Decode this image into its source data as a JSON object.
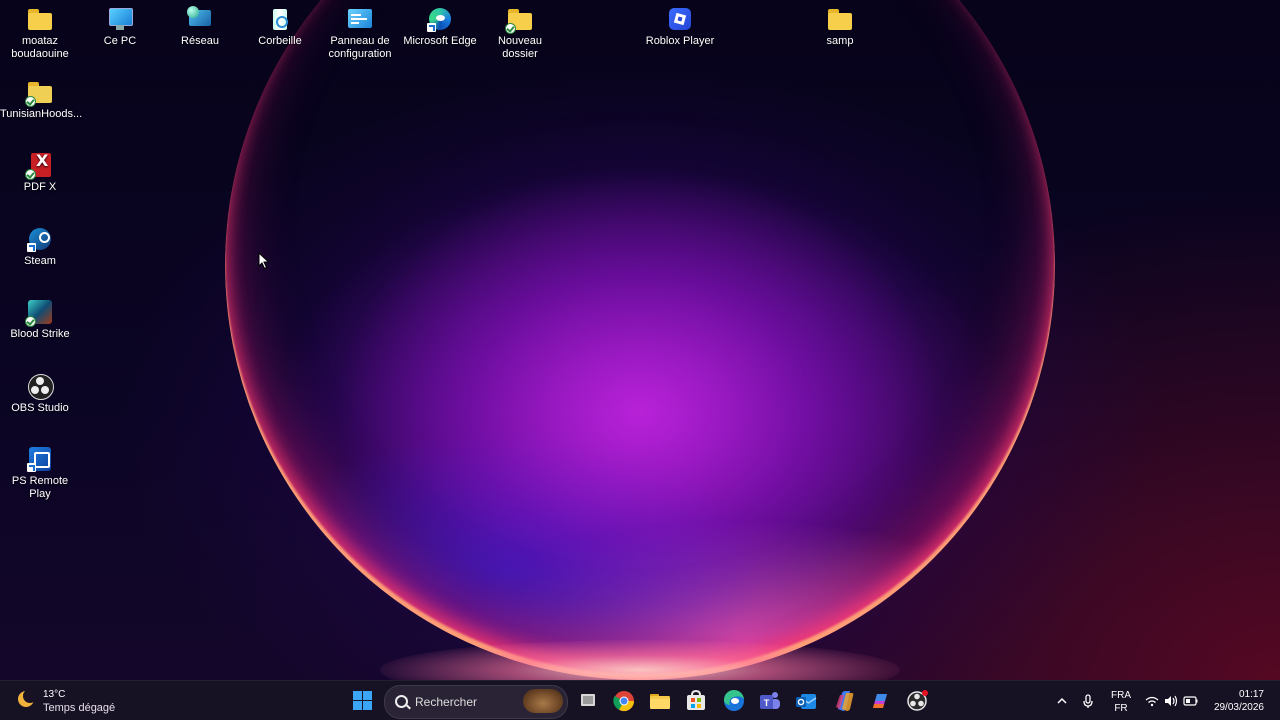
{
  "desktop": {
    "icons": [
      {
        "label": "moataz boudaouine",
        "icon": "folder-icon"
      },
      {
        "label": "Ce PC",
        "icon": "computer-icon"
      },
      {
        "label": "Réseau",
        "icon": "network-icon"
      },
      {
        "label": "Corbeille",
        "icon": "recycle-bin-icon"
      },
      {
        "label": "Panneau de configuration",
        "icon": "control-panel-icon"
      },
      {
        "label": "Microsoft Edge",
        "icon": "edge-icon"
      },
      {
        "label": "Nouveau dossier",
        "icon": "folder-icon"
      },
      {
        "label": "Roblox Player",
        "icon": "roblox-icon"
      },
      {
        "label": "samp",
        "icon": "folder-icon"
      },
      {
        "label": "TunisianHoods...",
        "icon": "folder-icon"
      },
      {
        "label": "PDF X",
        "icon": "pdf-icon"
      },
      {
        "label": "Steam",
        "icon": "steam-icon"
      },
      {
        "label": "Blood Strike",
        "icon": "game-icon"
      },
      {
        "label": "OBS Studio",
        "icon": "obs-icon"
      },
      {
        "label": "PS Remote Play",
        "icon": "ps-remote-play-icon"
      }
    ]
  },
  "taskbar": {
    "weather": {
      "temp": "13°C",
      "desc": "Temps dégagé",
      "icon": "moon-icon"
    },
    "search": {
      "placeholder": "Rechercher"
    },
    "apps": [
      "start-icon",
      "task-view-icon",
      "chrome-icon",
      "file-explorer-icon",
      "store-icon",
      "edge-icon",
      "teams-icon",
      "outlook-icon",
      "copilot-icon",
      "microsoft365-icon",
      "obs-icon"
    ],
    "tray": {
      "lang_top": "FRA",
      "lang_bottom": "FR",
      "time": "01:17",
      "date": "29/03/2026"
    }
  },
  "colors": {
    "taskbar_bg": "#181224",
    "accent": "#3aa6f5"
  }
}
